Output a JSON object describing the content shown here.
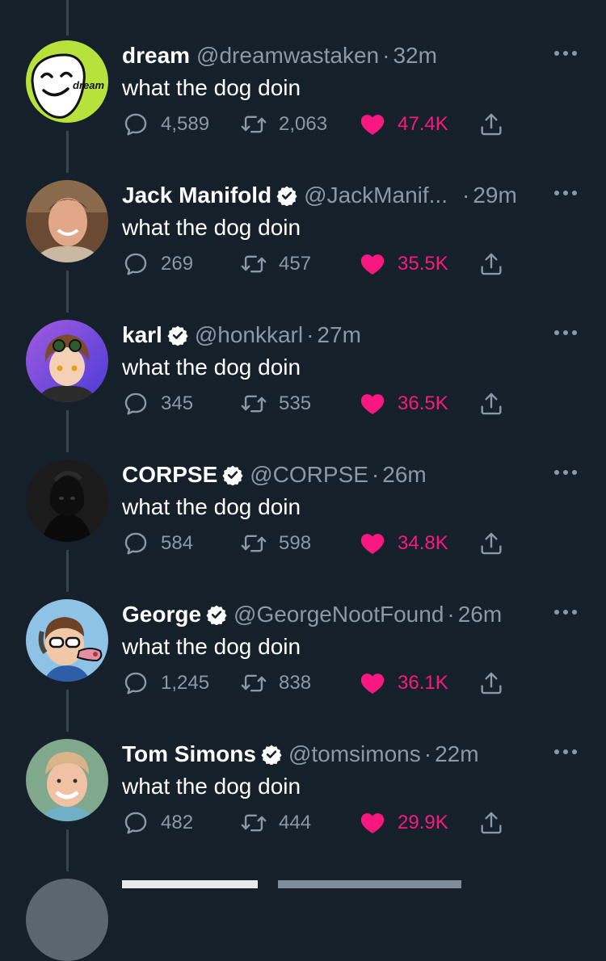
{
  "tweets": [
    {
      "name": "dream",
      "verified": false,
      "handle": "@dreamwastaken",
      "time": "32m",
      "text": "what the dog doin",
      "replies": "4,589",
      "retweets": "2,063",
      "likes": "47.4K",
      "avatar_label": "dream"
    },
    {
      "name": "Jack Manifold",
      "verified": true,
      "handle": "@JackManif...",
      "time": "29m",
      "text": "what the dog doin",
      "replies": "269",
      "retweets": "457",
      "likes": "35.5K"
    },
    {
      "name": "karl",
      "verified": true,
      "handle": "@honkkarl",
      "time": "27m",
      "text": "what the dog doin",
      "replies": "345",
      "retweets": "535",
      "likes": "36.5K"
    },
    {
      "name": "CORPSE",
      "verified": true,
      "handle": "@CORPSE",
      "time": "26m",
      "text": "what the dog doin",
      "replies": "584",
      "retweets": "598",
      "likes": "34.8K"
    },
    {
      "name": "George",
      "verified": true,
      "handle": "@GeorgeNootFound",
      "time": "26m",
      "text": "what the dog doin",
      "replies": "1,245",
      "retweets": "838",
      "likes": "36.1K"
    },
    {
      "name": "Tom Simons",
      "verified": true,
      "handle": "@tomsimons",
      "time": "22m",
      "text": "what the dog doin",
      "replies": "482",
      "retweets": "444",
      "likes": "29.9K"
    }
  ],
  "colors": {
    "background": "#15202b",
    "secondary_text": "#8b98a5",
    "like": "#f91880",
    "verified": "#ffffff",
    "thread_line": "#38444d"
  },
  "icons": [
    "reply-icon",
    "retweet-icon",
    "like-heart-icon",
    "share-icon",
    "verified-badge-icon",
    "more-options-icon"
  ]
}
